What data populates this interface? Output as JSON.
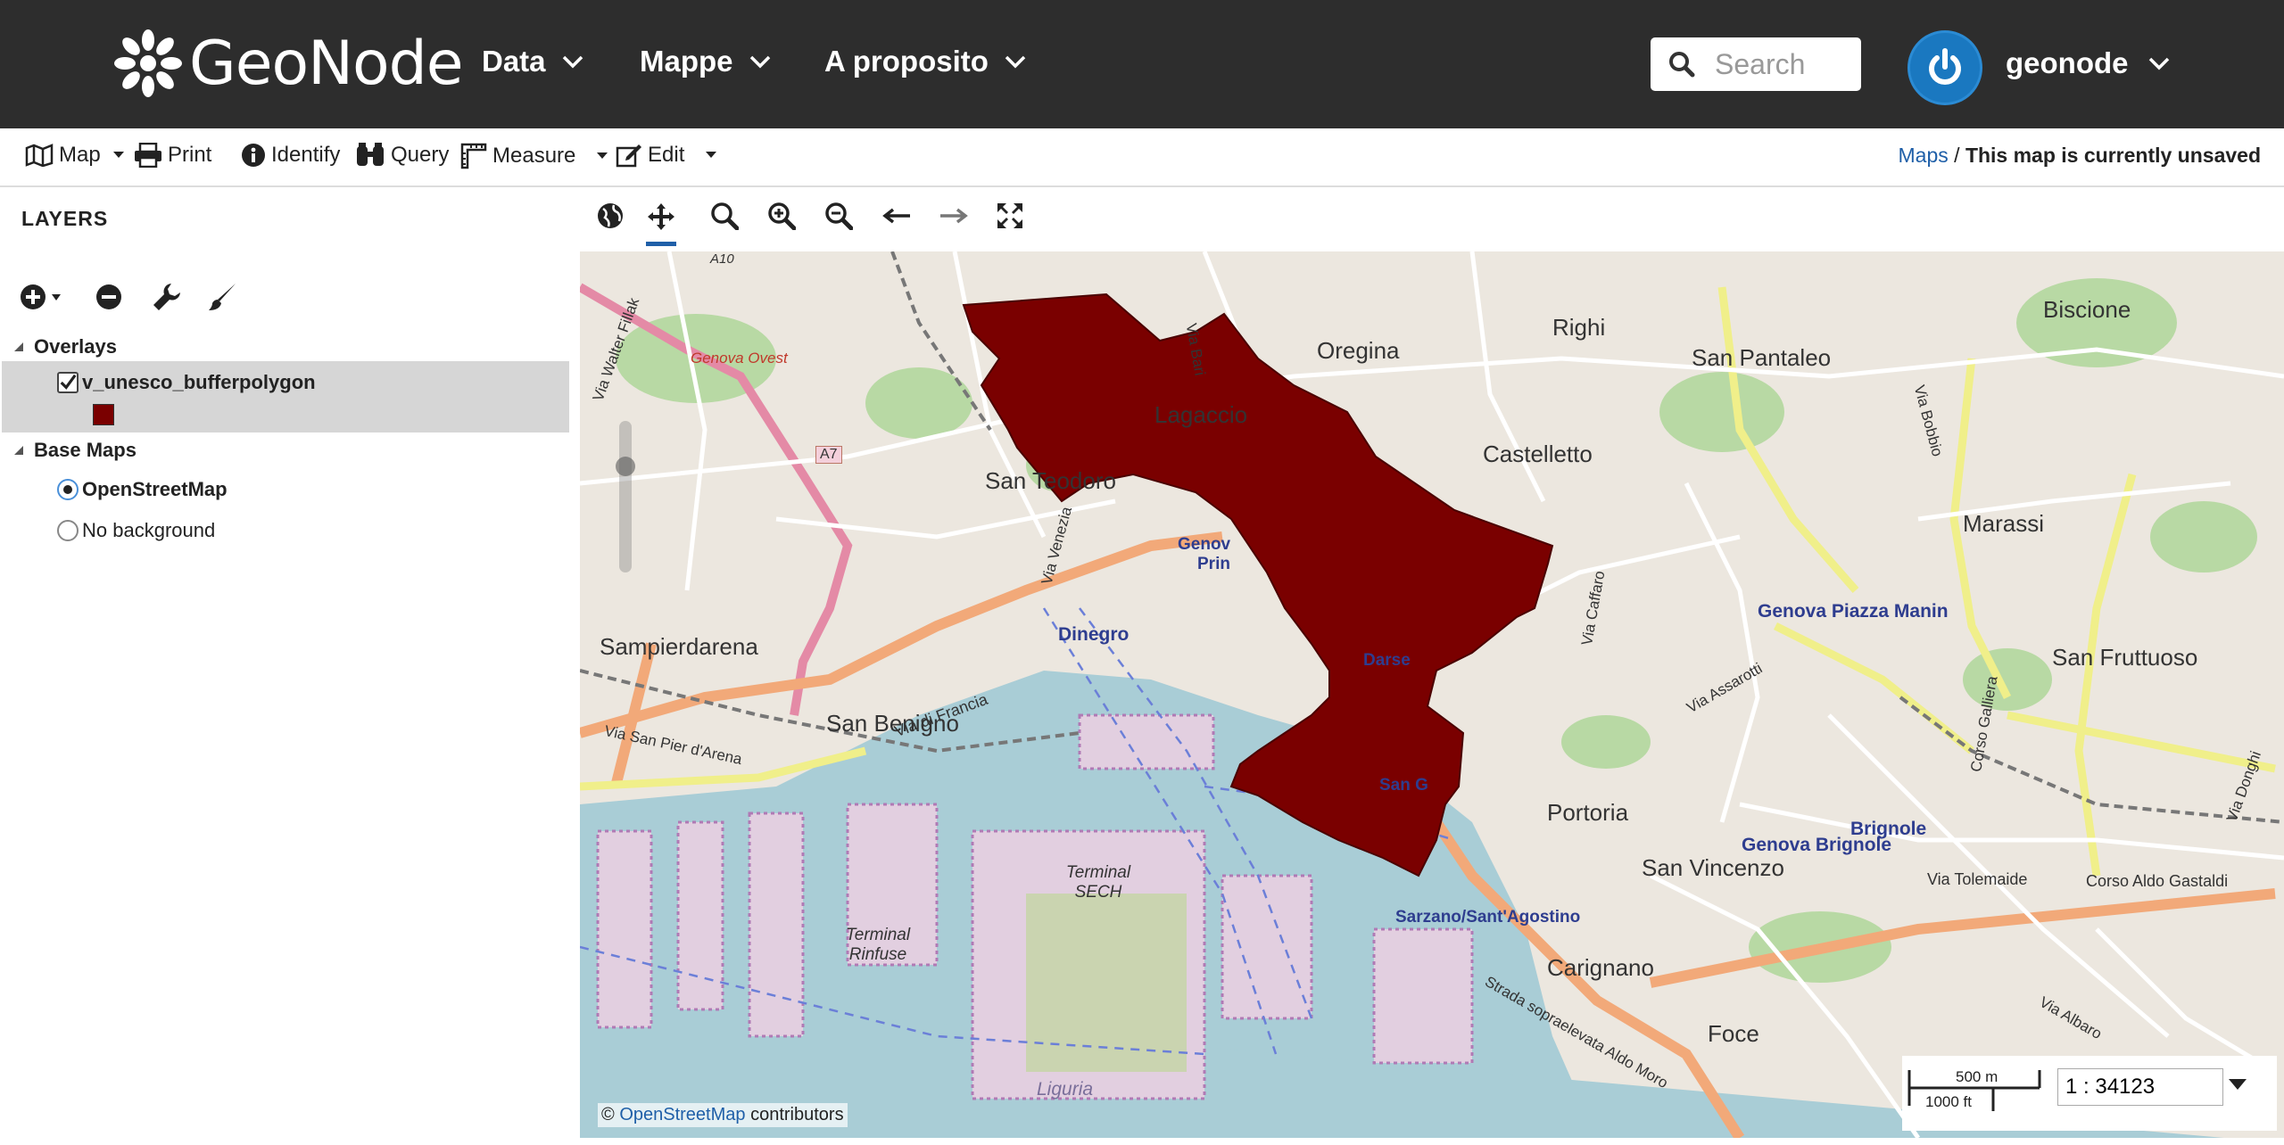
{
  "app": {
    "name": "GeoNode"
  },
  "topnav": {
    "menus": [
      {
        "label": "Data"
      },
      {
        "label": "Mappe"
      },
      {
        "label": "A proposito"
      }
    ],
    "search_placeholder": "Search",
    "user": "geonode"
  },
  "toolbar": {
    "map": "Map",
    "print": "Print",
    "identify": "Identify",
    "query": "Query",
    "measure": "Measure",
    "edit": "Edit"
  },
  "breadcrumb": {
    "link": "Maps",
    "separator": " / ",
    "current": "This map is currently unsaved"
  },
  "layers_panel": {
    "title": "LAYERS",
    "overlays_label": "Overlays",
    "overlay_layer": {
      "name": "v_unesco_bufferpolygon",
      "checked": true,
      "swatch_color": "#7a0000"
    },
    "basemaps_label": "Base Maps",
    "basemaps": [
      {
        "name": "OpenStreetMap",
        "selected": true
      },
      {
        "name": "No background",
        "selected": false
      }
    ]
  },
  "map": {
    "place_labels": [
      "Oregina",
      "Righi",
      "San Pantaleo",
      "Biscione",
      "Lagaccio",
      "Castelletto",
      "San Teodoro",
      "Marassi",
      "Sampierdarena",
      "Dinegro",
      "Genova Piazza Manin",
      "San Fruttuoso",
      "Via di Francia",
      "San Benigno",
      "Portoria",
      "Genova Brignole",
      "Brignole",
      "San Vincenzo",
      "Terminal SECH",
      "Terminal Rinfuse",
      "Sarzano/Sant'Agostino",
      "Carignano",
      "Foce",
      "Liguria",
      "Via Tolemaide",
      "Corso Aldo Gastaldi",
      "Via Assarotti",
      "Genova Ovest",
      "Via Walter Fillak",
      "Via San Pier d'Arena",
      "Strada sopraelevata Aldo Moro",
      "Via Albaro",
      "Corso Galliera",
      "Via Bobbio",
      "Via Venezia",
      "Via Bari",
      "Via Caffaro",
      "Via Donghi",
      "A7",
      "A10",
      "Darse",
      "San G",
      "Genov",
      "Prin"
    ],
    "polygon_color": "#7a0000",
    "attribution_prefix": "©",
    "attribution_link": "OpenStreetMap",
    "attribution_suffix": "contributors",
    "scale_metric": "500 m",
    "scale_imperial": "1000 ft",
    "scale_value": "1 : 34123"
  }
}
